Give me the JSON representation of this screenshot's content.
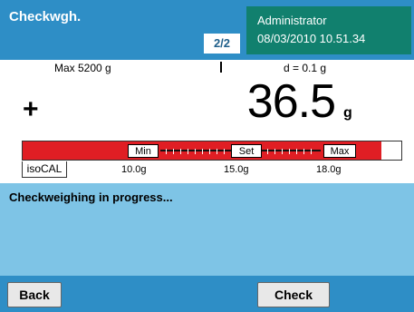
{
  "header": {
    "app_title": "Checkwgh.",
    "page_indicator": "2/2",
    "user": "Administrator",
    "datetime": "08/03/2010 10.51.34"
  },
  "weighing": {
    "max_capacity": "Max 5200 g",
    "readability": "d = 0.1 g",
    "sign": "+",
    "value": "36.5",
    "unit": "g"
  },
  "tolerance_bar": {
    "min_label": "Min",
    "set_label": "Set",
    "max_label": "Max",
    "isocal_label": "isoCAL",
    "min_value": "10.0g",
    "set_value": "15.0g",
    "max_value": "18.0g",
    "colors": {
      "out_of_range": "#e01e24",
      "in_range": "#111111"
    }
  },
  "status": {
    "message": "Checkweighing in progress..."
  },
  "footer": {
    "back_label": "Back",
    "check_label": "Check"
  },
  "colors": {
    "header_bg": "#2e8ec6",
    "user_box_bg": "#11806e",
    "status_bg": "#7ec4e6"
  }
}
